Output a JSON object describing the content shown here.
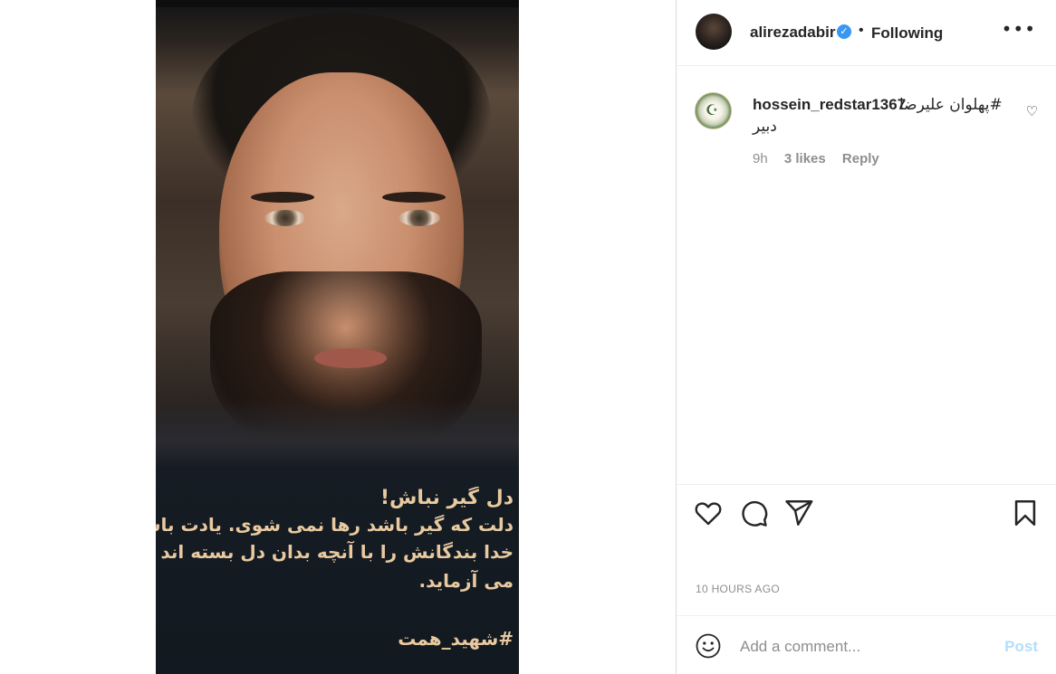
{
  "post": {
    "image_icon": "portrait-photo",
    "overlay_lines": [
      "دل گیر نباش!",
      "دلت که گیر باشد رها نمی شوی. یادت باشد",
      "خدا بندگانش را با آنچه بدان دل بسته اند",
      "می آزماید."
    ],
    "overlay_hashtag": "#شهید_همت"
  },
  "header": {
    "username": "alirezadabir",
    "verified_icon": "verified-badge-icon",
    "separator": "•",
    "follow_status": "Following",
    "more_icon": "more-options-icon",
    "more_glyph": "•••"
  },
  "comment": {
    "username": "hossein_redstar1367",
    "text_line1": "#پهلوان علیرضا",
    "text_line2": "دبیر",
    "time": "9h",
    "likes": "3 likes",
    "reply": "Reply",
    "like_icon": "heart-outline-icon",
    "like_glyph": "♡"
  },
  "actions": {
    "like_icon": "heart-icon",
    "comment_icon": "comment-icon",
    "share_icon": "send-icon",
    "save_icon": "bookmark-icon"
  },
  "timestamp": "10 HOURS AGO",
  "add_comment": {
    "emoji_icon": "emoji-icon",
    "placeholder": "Add a comment...",
    "post_label": "Post"
  },
  "colors": {
    "accent_blue": "#3897f0",
    "post_disabled": "#b2dffc",
    "muted_text": "#8e8e8e",
    "overlay_text": "#e8c9a0"
  }
}
